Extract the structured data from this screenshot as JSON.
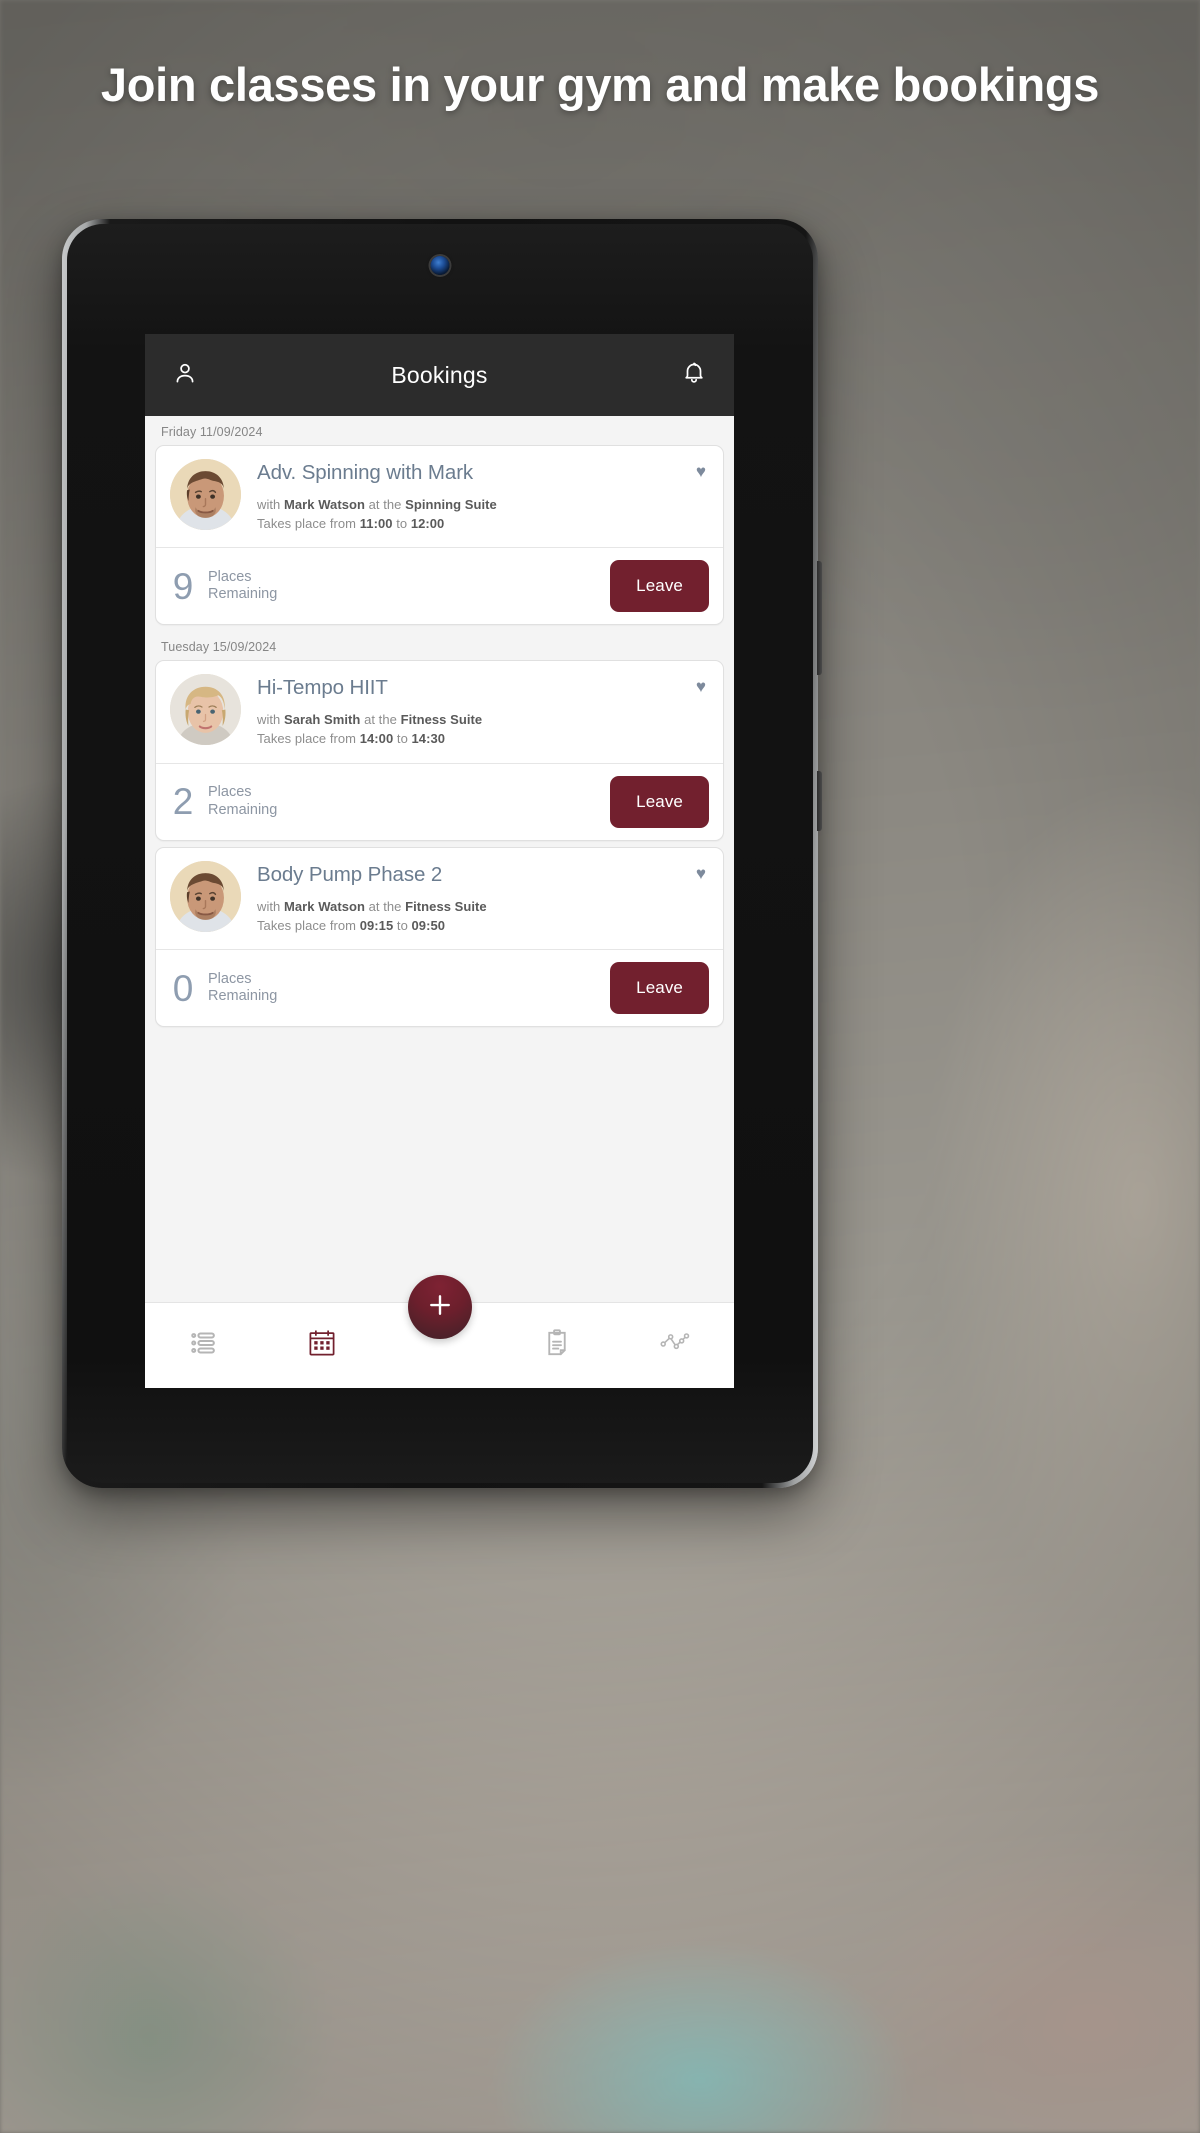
{
  "headline": "Join classes in your gym and make bookings",
  "colors": {
    "accent_maroon": "#72202e",
    "header_dark": "#2c2c2c",
    "title_blue_gray": "#6b7c8f",
    "places_gray": "#8e9db0",
    "screen_bg": "#f4f4f4"
  },
  "app": {
    "header": {
      "profile_icon": "person-icon",
      "title": "Bookings",
      "notification_icon": "bell-icon"
    },
    "groups": [
      {
        "day_label": "Friday 11/09/2024",
        "bookings": [
          {
            "title": "Adv. Spinning with Mark",
            "with_prefix": "with",
            "instructor": "Mark Watson",
            "at_text": "at the",
            "location": "Spinning Suite",
            "time_prefix": "Takes place from",
            "start_time": "11:00",
            "time_join": "to",
            "end_time": "12:00",
            "favourite_icon": "heart-icon",
            "places_count": "9",
            "places_line1": "Places",
            "places_line2": "Remaining",
            "action_label": "Leave",
            "avatar": "male-brown-hair"
          }
        ]
      },
      {
        "day_label": "Tuesday 15/09/2024",
        "bookings": [
          {
            "title": "Hi-Tempo HIIT",
            "with_prefix": "with",
            "instructor": "Sarah Smith",
            "at_text": "at the",
            "location": "Fitness Suite",
            "time_prefix": "Takes place from",
            "start_time": "14:00",
            "time_join": "to",
            "end_time": "14:30",
            "favourite_icon": "heart-icon",
            "places_count": "2",
            "places_line1": "Places",
            "places_line2": "Remaining",
            "action_label": "Leave",
            "avatar": "female-blonde-hair"
          },
          {
            "title": "Body Pump Phase 2",
            "with_prefix": "with",
            "instructor": "Mark Watson",
            "at_text": "at the",
            "location": "Fitness Suite",
            "time_prefix": "Takes place from",
            "start_time": "09:15",
            "time_join": "to",
            "end_time": "09:50",
            "favourite_icon": "heart-icon",
            "places_count": "0",
            "places_line1": "Places",
            "places_line2": "Remaining",
            "action_label": "Leave",
            "avatar": "male-brown-hair"
          }
        ]
      }
    ],
    "bottom_nav": [
      {
        "icon": "list-icon",
        "active": false
      },
      {
        "icon": "calendar-icon",
        "active": true
      },
      {
        "icon": "plus-icon",
        "active": false
      },
      {
        "icon": "clipboard-icon",
        "active": false
      },
      {
        "icon": "analytics-icon",
        "active": false
      }
    ]
  }
}
